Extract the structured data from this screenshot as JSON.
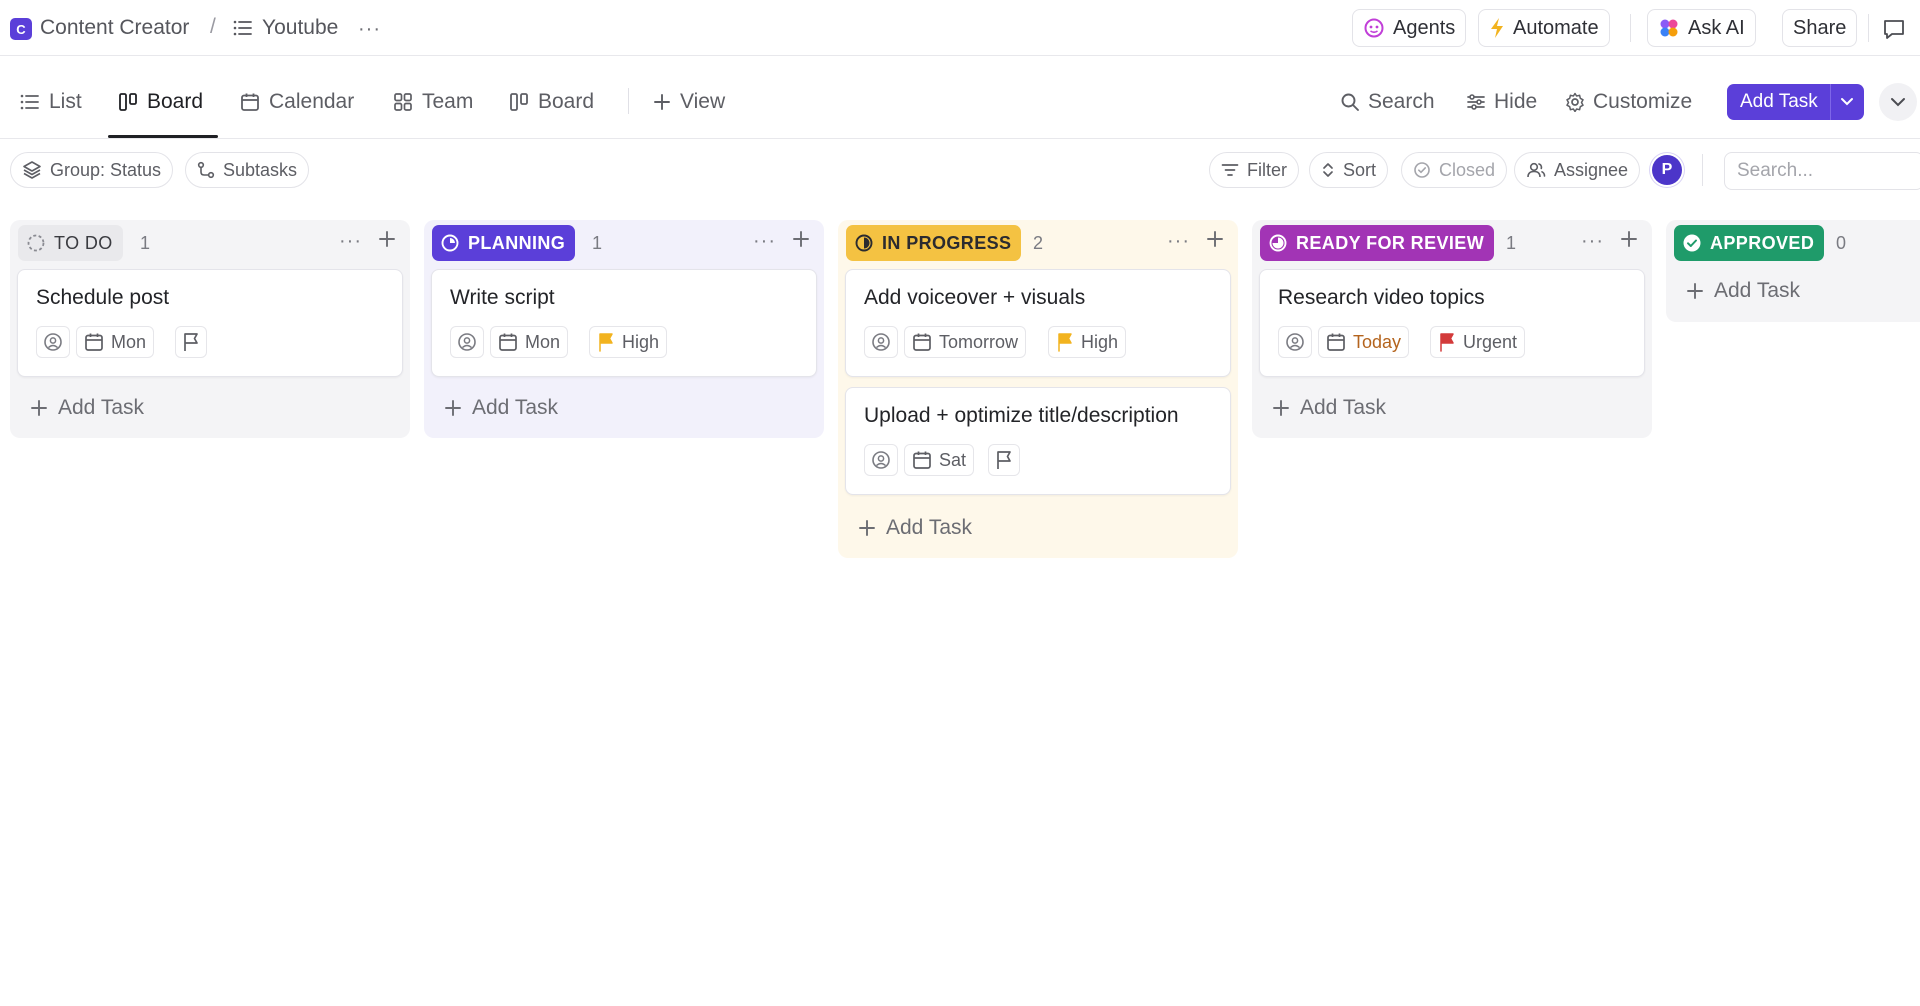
{
  "breadcrumb": {
    "workspace_initial": "C",
    "workspace": "Content Creator",
    "separator": "/",
    "list": "Youtube",
    "more": "···"
  },
  "topbar": {
    "agents": "Agents",
    "automate": "Automate",
    "ask_ai": "Ask AI",
    "share": "Share"
  },
  "views": {
    "tabs": [
      {
        "label": "List",
        "icon": "list-icon"
      },
      {
        "label": "Board",
        "icon": "board-icon",
        "active": true
      },
      {
        "label": "Calendar",
        "icon": "calendar-icon"
      },
      {
        "label": "Team",
        "icon": "grid-icon"
      },
      {
        "label": "Board",
        "icon": "board-icon"
      }
    ],
    "add_view": "View",
    "search": "Search",
    "hide": "Hide",
    "customize": "Customize",
    "add_task": "Add Task"
  },
  "filters": {
    "group": "Group: Status",
    "subtasks": "Subtasks",
    "filter": "Filter",
    "sort": "Sort",
    "closed": "Closed",
    "assignee": "Assignee",
    "avatar_initial": "P",
    "search_placeholder": "Search..."
  },
  "columns": [
    {
      "name": "TO DO",
      "count": "1",
      "color": "#e9e9ec",
      "text_color": "#3a3b40",
      "bg": "#f4f4f6",
      "cards": [
        {
          "title": "Schedule post",
          "date": "Mon",
          "priority": "",
          "priority_color": ""
        }
      ],
      "add_task": "Add Task"
    },
    {
      "name": "PLANNING",
      "count": "1",
      "color": "#5b3fd9",
      "text_color": "#ffffff",
      "bg": "#f2f1fb",
      "cards": [
        {
          "title": "Write script",
          "date": "Mon",
          "priority": "High",
          "priority_color": "#f2b31f"
        }
      ],
      "add_task": "Add Task"
    },
    {
      "name": "IN PROGRESS",
      "count": "2",
      "color": "#f4c242",
      "text_color": "#2b2b2f",
      "bg": "#fef8ea",
      "cards": [
        {
          "title": "Add voiceover + visuals",
          "date": "Tomorrow",
          "priority": "High",
          "priority_color": "#f2b31f"
        },
        {
          "title": "Upload + optimize title/description",
          "date": "Sat",
          "priority": "",
          "priority_color": ""
        }
      ],
      "add_task": "Add Task"
    },
    {
      "name": "READY FOR REVIEW",
      "count": "1",
      "color": "#a234b5",
      "text_color": "#ffffff",
      "bg": "#f4f4f6",
      "cards": [
        {
          "title": "Research video topics",
          "date": "Today",
          "priority": "Urgent",
          "priority_color": "#d33a3a"
        }
      ],
      "add_task": "Add Task"
    },
    {
      "name": "APPROVED",
      "count": "0",
      "color": "#1f9b6a",
      "text_color": "#ffffff",
      "bg": "#f4f4f6",
      "cards": [],
      "add_task": "Add Task"
    }
  ]
}
